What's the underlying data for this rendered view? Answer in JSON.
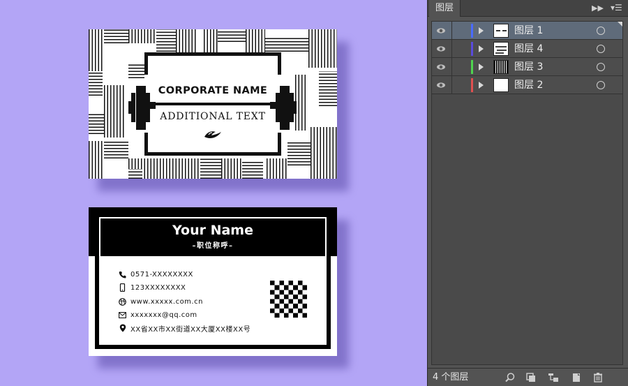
{
  "front_card": {
    "title": "CORPORATE NAME",
    "subtitle": "ADDITIONAL TEXT",
    "logo_icon": "bird-logo-icon"
  },
  "back_card": {
    "name": "Your Name",
    "job_title": "–职位称呼–",
    "contacts": [
      {
        "icon": "phone-icon",
        "text": "0571-XXXXXXXX"
      },
      {
        "icon": "mobile-icon",
        "text": "123XXXXXXXX"
      },
      {
        "icon": "globe-icon",
        "text": "www.xxxxx.com.cn"
      },
      {
        "icon": "mail-icon",
        "text": "xxxxxxx@qq.com"
      },
      {
        "icon": "location-pin-icon",
        "text": "XX省XX市XX街道XX大厦XX楼XX号"
      }
    ],
    "qr_icon": "qr-code-icon"
  },
  "layers_panel": {
    "tab_label": "图层",
    "collapse_icon": "double-arrow-icon",
    "menu_icon": "panel-menu-icon",
    "layers": [
      {
        "name": "图层 1",
        "color": "#4a6bff",
        "selected": true
      },
      {
        "name": "图层 4",
        "color": "#5a4bdc",
        "selected": false
      },
      {
        "name": "图层 3",
        "color": "#4fd34f",
        "selected": false
      },
      {
        "name": "图层 2",
        "color": "#e05050",
        "selected": false
      }
    ],
    "footer": {
      "count_label": "4 个图层",
      "buttons": [
        "locate-object-icon",
        "make-clipping-mask-icon",
        "create-sublayer-icon",
        "create-new-layer-icon",
        "trash-icon"
      ]
    }
  },
  "colors": {
    "canvas_bg": "#b3a5f6",
    "panel_bg": "#535353",
    "selected_row": "#5f6b7a"
  }
}
